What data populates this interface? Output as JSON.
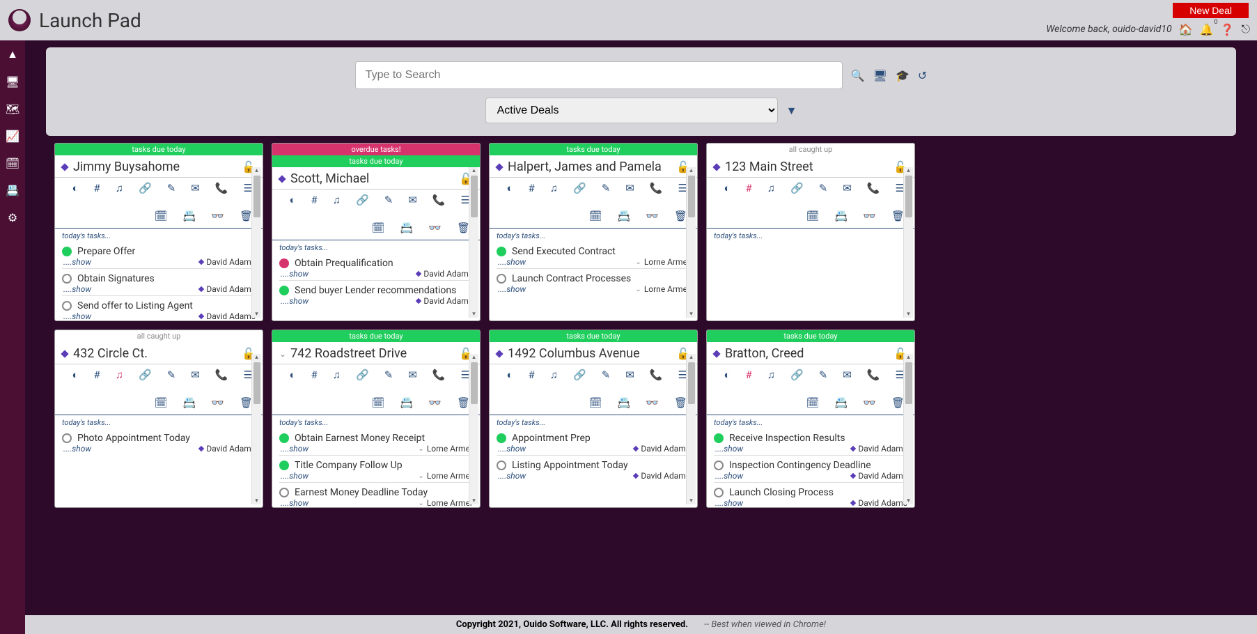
{
  "page_title": "Launch Pad",
  "new_deal_label": "New Deal",
  "welcome_text": "Welcome back, ouido-david10",
  "notif_badge": "0",
  "search": {
    "placeholder": "Type to Search",
    "filter_selected": "Active Deals"
  },
  "footer": {
    "copyright": "Copyright 2021, Ouido Software, LLC. All rights reserved.",
    "best_viewed": "-- Best when viewed in Chrome!"
  },
  "banners": {
    "due": "tasks due today",
    "overdue": "overdue tasks!",
    "caught": "all caught up"
  },
  "tasks_label": "today's tasks...",
  "show_label": "....show",
  "cards": [
    {
      "title": "Jimmy Buysahome",
      "banners": [
        "due"
      ],
      "marker": "diamond",
      "red_icons": [],
      "tasks": [
        {
          "dot": "green",
          "name": "Prepare Offer",
          "assignee": "David Adams",
          "atype": "diamond"
        },
        {
          "dot": "open",
          "name": "Obtain Signatures",
          "assignee": "David Adams",
          "atype": "diamond"
        },
        {
          "dot": "open",
          "name": "Send offer to Listing Agent",
          "assignee": "David Adams",
          "atype": "diamond"
        }
      ]
    },
    {
      "title": "Scott, Michael",
      "banners": [
        "overdue",
        "due"
      ],
      "marker": "diamond",
      "red_icons": [],
      "tasks": [
        {
          "dot": "red",
          "name": "Obtain Prequalification",
          "assignee": "David Adams",
          "atype": "diamond"
        },
        {
          "dot": "green",
          "name": "Send buyer Lender recommendations",
          "assignee": "David Adams",
          "atype": "diamond"
        }
      ]
    },
    {
      "title": "Halpert, James and Pamela",
      "banners": [
        "due"
      ],
      "marker": "diamond",
      "red_icons": [],
      "tasks": [
        {
          "dot": "green",
          "name": "Send Executed Contract",
          "assignee": "Lorne Armer",
          "atype": "chev"
        },
        {
          "dot": "open",
          "name": "Launch Contract Processes",
          "assignee": "Lorne Armer",
          "atype": "chev"
        }
      ]
    },
    {
      "title": "123 Main Street",
      "banners": [
        "caught"
      ],
      "marker": "diamond",
      "red_icons": [
        "hash"
      ],
      "tasks": []
    },
    {
      "title": "432 Circle Ct.",
      "banners": [
        "caught"
      ],
      "marker": "diamond",
      "red_icons": [
        "music"
      ],
      "tasks": [
        {
          "dot": "open",
          "name": "Photo Appointment Today",
          "assignee": "David Adams",
          "atype": "diamond"
        }
      ]
    },
    {
      "title": "742 Roadstreet Drive",
      "banners": [
        "due"
      ],
      "marker": "chev",
      "red_icons": [],
      "tasks": [
        {
          "dot": "green",
          "name": "Obtain Earnest Money Receipt",
          "assignee": "Lorne Armer",
          "atype": "chev"
        },
        {
          "dot": "green",
          "name": "Title Company Follow Up",
          "assignee": "Lorne Armer",
          "atype": "chev"
        },
        {
          "dot": "open",
          "name": "Earnest Money Deadline Today",
          "assignee": "Lorne Armer",
          "atype": "chev"
        }
      ]
    },
    {
      "title": "1492 Columbus Avenue",
      "banners": [
        "due"
      ],
      "marker": "diamond",
      "red_icons": [],
      "tasks": [
        {
          "dot": "green",
          "name": "Appointment Prep",
          "assignee": "David Adams",
          "atype": "diamond"
        },
        {
          "dot": "open",
          "name": "Listing Appointment Today",
          "assignee": "David Adams",
          "atype": "diamond"
        }
      ]
    },
    {
      "title": "Bratton, Creed",
      "banners": [
        "due"
      ],
      "marker": "diamond",
      "red_icons": [
        "hash",
        "link"
      ],
      "tasks": [
        {
          "dot": "green",
          "name": "Receive Inspection Results",
          "assignee": "David Adams",
          "atype": "diamond"
        },
        {
          "dot": "open",
          "name": "Inspection Contingency Deadline",
          "assignee": "David Adams",
          "atype": "diamond"
        },
        {
          "dot": "open",
          "name": "Launch Closing Process",
          "assignee": "David Adams",
          "atype": "diamond"
        }
      ]
    }
  ]
}
